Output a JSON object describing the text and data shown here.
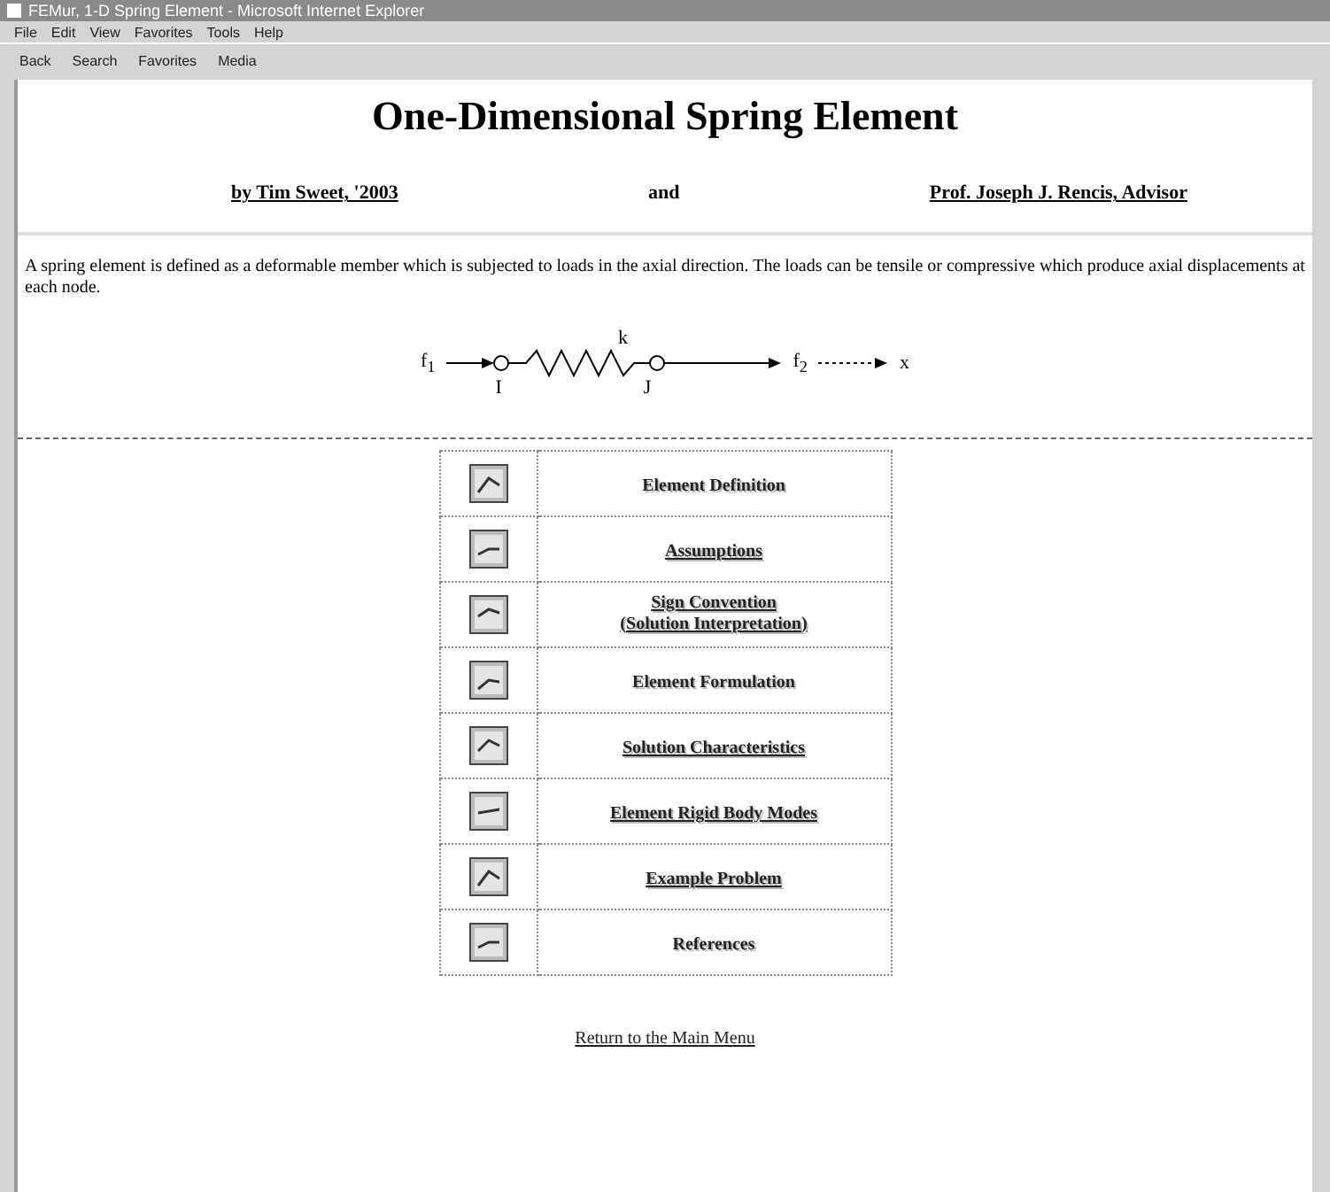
{
  "window": {
    "title": "FEMur, 1-D Spring Element - Microsoft Internet Explorer"
  },
  "menu_bar": [
    "File",
    "Edit",
    "View",
    "Favorites",
    "Tools",
    "Help"
  ],
  "toolbar": [
    "Back",
    "Search",
    "Favorites",
    "Media"
  ],
  "page": {
    "title": "One-Dimensional Spring Element",
    "byline": [
      {
        "text": "by Tim Sweet, '2003",
        "link": true
      },
      {
        "text": "and",
        "link": false
      },
      {
        "text": "Prof. Joseph J. Rencis, Advisor",
        "link": true
      }
    ],
    "intro": "A spring element is defined as a deformable member which is subjected to loads in the axial direction. The loads can be tensile or compressive which produce axial displacements at each node.",
    "diagram": {
      "force_left": "f$_{1}$",
      "stiffness": "k",
      "node_left": "I",
      "node_right": "J",
      "force_right": "f$_{2}$",
      "axis": "x"
    },
    "topics": [
      {
        "lines": [
          "Element Definition"
        ],
        "link": false
      },
      {
        "lines": [
          "Assumptions"
        ],
        "link": true
      },
      {
        "lines": [
          "Sign Convention",
          "(Solution Interpretation)"
        ],
        "link": true
      },
      {
        "lines": [
          "Element Formulation"
        ],
        "link": false
      },
      {
        "lines": [
          "Solution Characteristics"
        ],
        "link": true
      },
      {
        "lines": [
          "Element Rigid Body Modes"
        ],
        "link": true
      },
      {
        "lines": [
          "Example Problem"
        ],
        "link": true
      },
      {
        "lines": [
          "References"
        ],
        "link": false
      }
    ],
    "return_link": "Return to the Main Menu"
  }
}
